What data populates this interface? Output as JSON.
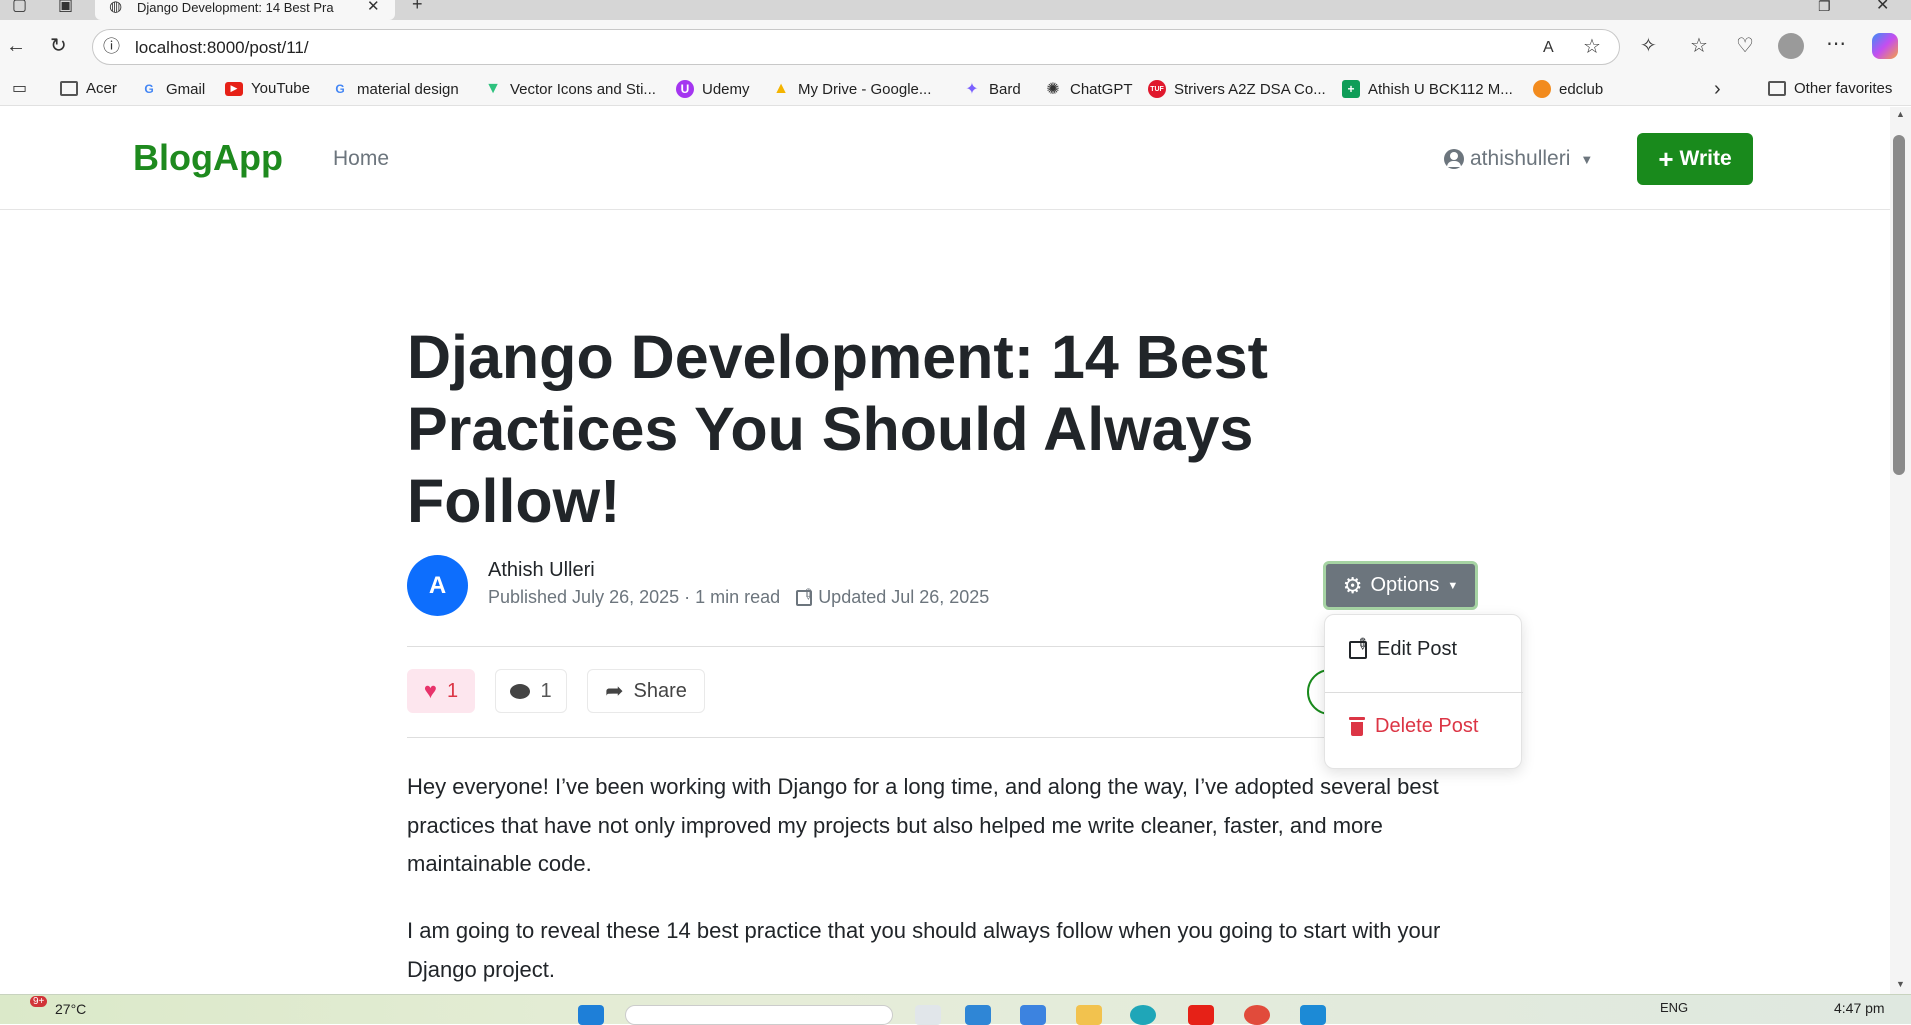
{
  "browser": {
    "tab_title": "Django Development: 14 Best Pra",
    "url": "localhost:8000/post/11/",
    "favorites": [
      {
        "label": "Acer",
        "icon": "folder-icon"
      },
      {
        "label": "Gmail",
        "icon": "google-icon"
      },
      {
        "label": "YouTube",
        "icon": "youtube-icon"
      },
      {
        "label": "material design",
        "icon": "google-icon"
      },
      {
        "label": "Vector Icons and Sti...",
        "icon": "vector-icon"
      },
      {
        "label": "Udemy",
        "icon": "udemy-icon"
      },
      {
        "label": "My Drive - Google...",
        "icon": "drive-icon"
      },
      {
        "label": "Bard",
        "icon": "sparkle-icon"
      },
      {
        "label": "ChatGPT",
        "icon": "chatgpt-icon"
      },
      {
        "label": "Strivers A2Z DSA Co...",
        "icon": "tuf-icon"
      },
      {
        "label": "Athish U BCK112 M...",
        "icon": "sheets-icon"
      },
      {
        "label": "edclub",
        "icon": "edclub-icon"
      }
    ],
    "other_favorites": "Other favorites"
  },
  "navbar": {
    "brand": "BlogApp",
    "home": "Home",
    "username": "athishulleri",
    "write": "Write"
  },
  "post": {
    "title": "Django Development: 14 Best Practices You Should Always Follow!",
    "author_initial": "A",
    "author_name": "Athish Ulleri",
    "published": "Published July 26, 2025 · 1 min read",
    "updated": "Updated Jul 26, 2025",
    "likes": "1",
    "comments": "1",
    "share": "Share",
    "paragraphs": [
      "Hey everyone! I’ve been working with Django for a long time, and along the way, I’ve adopted several best practices that have not only improved my projects but also helped me write cleaner, faster, and more maintainable code.",
      "I am going to reveal these 14 best practice that you should always follow when you going to start with your Django project."
    ]
  },
  "options_menu": {
    "button": "Options",
    "edit": "Edit Post",
    "delete": "Delete Post"
  },
  "taskbar": {
    "notification_count": "9+",
    "weather": "27°C",
    "lang": "ENG",
    "time": "4:47 pm"
  },
  "colors": {
    "brand_green": "#1e8a1e",
    "write_button": "#198a1c",
    "options_button": "#6c757d",
    "danger": "#dc3545",
    "like_bg": "#fde6ee",
    "avatar_blue": "#0d6efd"
  }
}
